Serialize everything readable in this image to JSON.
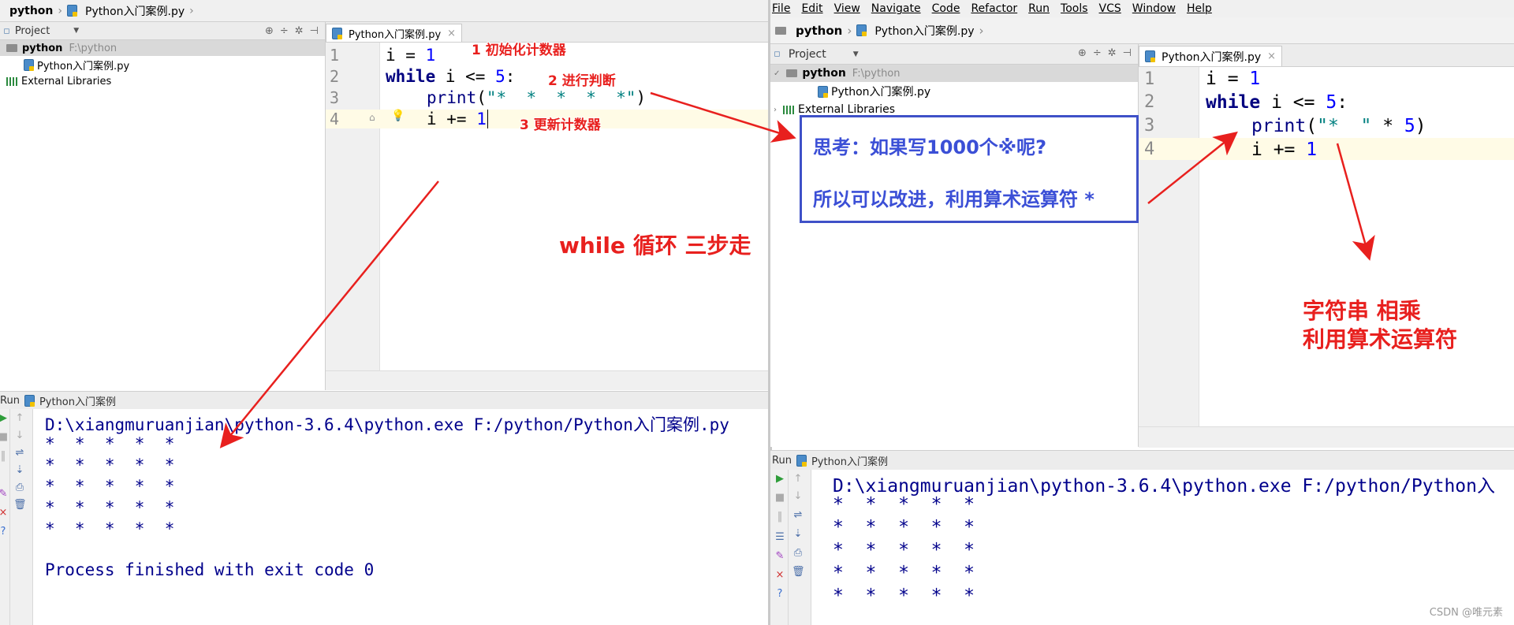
{
  "left": {
    "breadcrumb": {
      "project": "python",
      "file": "Python入门案例.py"
    },
    "project_panel": {
      "title": "Project",
      "root": {
        "name": "python",
        "path": "F:\\python"
      },
      "file": "Python入门案例.py",
      "external": "External Libraries"
    },
    "editor": {
      "tab": "Python入门案例.py",
      "line_numbers": [
        "1",
        "2",
        "3",
        "4"
      ],
      "code": {
        "l1": {
          "name": "i",
          "op": " = ",
          "val": "1"
        },
        "l2": {
          "kw": "while",
          "rest": " i <= ",
          "val": "5",
          "colon": ":"
        },
        "l3": {
          "fn": "print",
          "paren_open": "(",
          "str": "\"*  *  *  *  *\"",
          "paren_close": ")"
        },
        "l4": {
          "rest": "i += ",
          "val": "1"
        }
      }
    },
    "run": {
      "label": "Python入门案例",
      "command": "D:\\xiangmuruanjian\\python-3.6.4\\python.exe F:/python/Python入门案例.py",
      "output": [
        "*  *  *  *  *",
        "*  *  *  *  *",
        "*  *  *  *  *",
        "*  *  *  *  *",
        "*  *  *  *  *"
      ],
      "finish": "Process finished with exit code 0"
    },
    "annotations": {
      "a1": "1  初始化计数器",
      "a2": "2  进行判断",
      "a3": "3  更新计数器",
      "big": "while 循环  三步走"
    }
  },
  "right": {
    "menu": [
      "File",
      "Edit",
      "View",
      "Navigate",
      "Code",
      "Refactor",
      "Run",
      "Tools",
      "VCS",
      "Window",
      "Help"
    ],
    "breadcrumb": {
      "project": "python",
      "file": "Python入门案例.py"
    },
    "project_panel": {
      "title": "Project",
      "root": {
        "name": "python",
        "path": "F:\\python"
      },
      "file": "Python入门案例.py",
      "external": "External Libraries"
    },
    "editor": {
      "tab": "Python入门案例.py",
      "line_numbers": [
        "1",
        "2",
        "3",
        "4"
      ],
      "code": {
        "l1": {
          "name": "i",
          "op": " = ",
          "val": "1"
        },
        "l2": {
          "kw": "while",
          "rest": " i <= ",
          "val": "5",
          "colon": ":"
        },
        "l3": {
          "fn": "print",
          "paren_open": "(",
          "str": "\"*  \"",
          "rest": " * ",
          "val": "5",
          "paren_close": ")"
        },
        "l4": {
          "rest": "i += ",
          "val": "1"
        }
      }
    },
    "thought_box": {
      "line1": "思考：如果写1000个※呢?",
      "line2": "所以可以改进，利用算术运算符 *"
    },
    "annotation": {
      "line1": "字符串   相乘",
      "line2": "利用算术运算符"
    },
    "run": {
      "label": "Python入门案例",
      "command": "D:\\xiangmuruanjian\\python-3.6.4\\python.exe F:/python/Python入",
      "output": [
        "*  *  *  *  *",
        "*  *  *  *  *",
        "*  *  *  *  *",
        "*  *  *  *  *",
        "*  *  *  *  *"
      ]
    }
  },
  "run_tab": "Run",
  "watermark": "CSDN @唯元素",
  "colors": {
    "annotation": "#e8201e",
    "box": "#3f51c8",
    "keyword": "#000080",
    "number": "#0000ff",
    "string": "#008080",
    "console": "#00008b"
  }
}
